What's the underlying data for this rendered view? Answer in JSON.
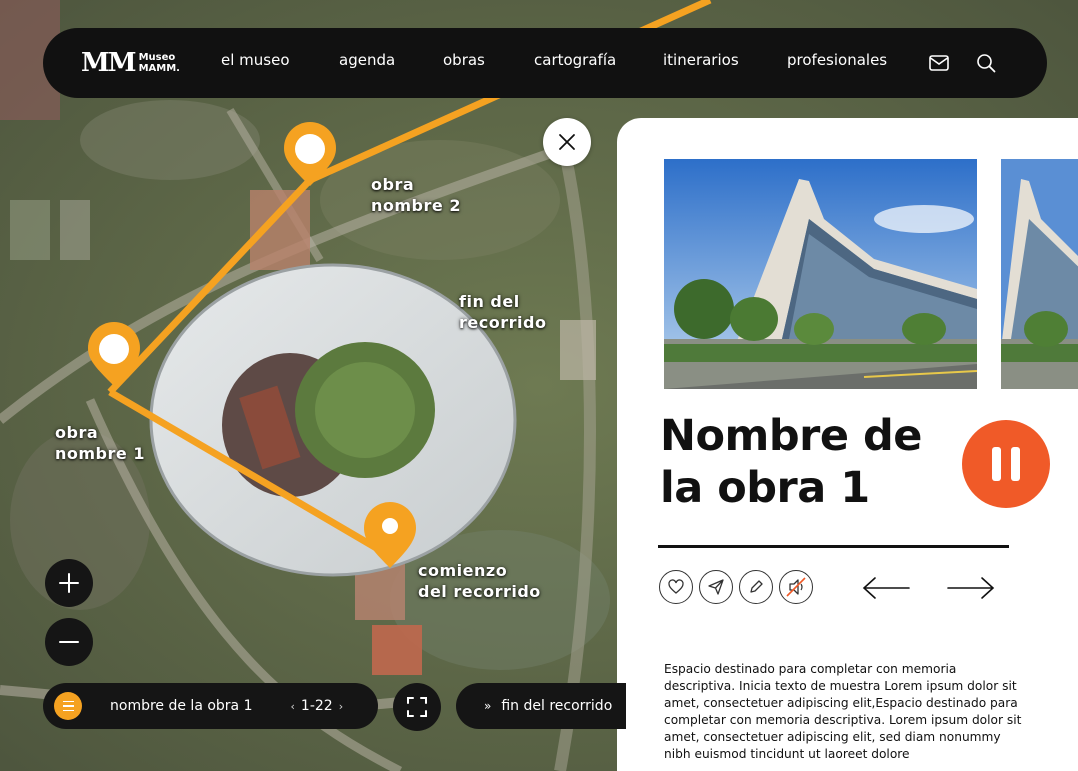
{
  "brand": {
    "logo_mark": "MM",
    "logo_line1": "Museo",
    "logo_line2": "MAMM."
  },
  "nav": {
    "items": [
      "el museo",
      "agenda",
      "obras",
      "cartografía",
      "itinerarios",
      "profesionales"
    ],
    "icons": [
      "mail-icon",
      "search-icon"
    ]
  },
  "map": {
    "labels": {
      "obra2": [
        "obra",
        "nombre 2"
      ],
      "fin": [
        "fin del",
        "recorrido"
      ],
      "obra1": [
        "obra",
        "nombre 1"
      ],
      "comienzo": [
        "comienzo",
        "del recorrido"
      ]
    },
    "route_color": "#f5a221",
    "zoom_in": "+",
    "zoom_out": "−"
  },
  "bottom_bar": {
    "title": "nombre de la obra 1",
    "pager": "1-22",
    "next_prefix": "»",
    "next_label": "fin del recorrido"
  },
  "panel": {
    "title": "Nombre de la obra 1",
    "description": "Espacio destinado para completar con memoria descriptiva. Inicia texto de muestra Lorem ipsum dolor sit amet, consectetuer adipiscing elit,Espacio destinado para completar con memoria descriptiva. Lorem ipsum dolor sit amet, consectetuer adipiscing elit, sed diam nonummy nibh euismod tincidunt ut laoreet dolore",
    "actions": [
      "heart-icon",
      "send-icon",
      "pencil-icon",
      "muted-speaker-icon"
    ],
    "accent": "#f05a28"
  }
}
